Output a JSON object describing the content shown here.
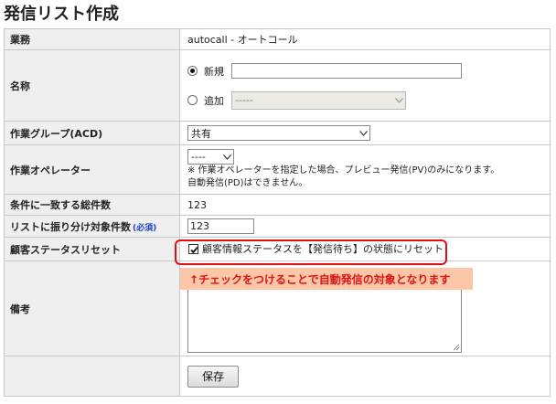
{
  "page_title": "発信リスト作成",
  "rows": {
    "business": {
      "label": "業務",
      "value": "autocall - オートコール"
    },
    "name": {
      "label": "名称",
      "new_label": "新規",
      "new_value": "",
      "add_label": "追加",
      "add_select_value": "-----"
    },
    "work_group": {
      "label": "作業グループ(ACD)",
      "value": "共有"
    },
    "operator": {
      "label": "作業オペレーター",
      "select_value": "----",
      "note_line1": "※ 作業オペレーターを指定した場合、プレビュー発信(PV)のみになります。",
      "note_line2": "自動発信(PD)はできません。"
    },
    "total_match": {
      "label": "条件に一致する総件数",
      "value": "123"
    },
    "assign_count": {
      "label": "リストに振り分け対象件数",
      "required": "(必須)",
      "value": "123"
    },
    "status_reset": {
      "label": "顧客ステータスリセット",
      "checkbox_label": "顧客情報ステータスを【発信待ち】の状態にリセット",
      "checked": true
    },
    "remarks": {
      "label": "備考",
      "value": ""
    }
  },
  "annotation": {
    "text": "↑チェックをつけることで自動発信の対象となります",
    "highlight_color": "#e01010",
    "banner_color": "#fbc7a7"
  },
  "buttons": {
    "save": "保存"
  }
}
